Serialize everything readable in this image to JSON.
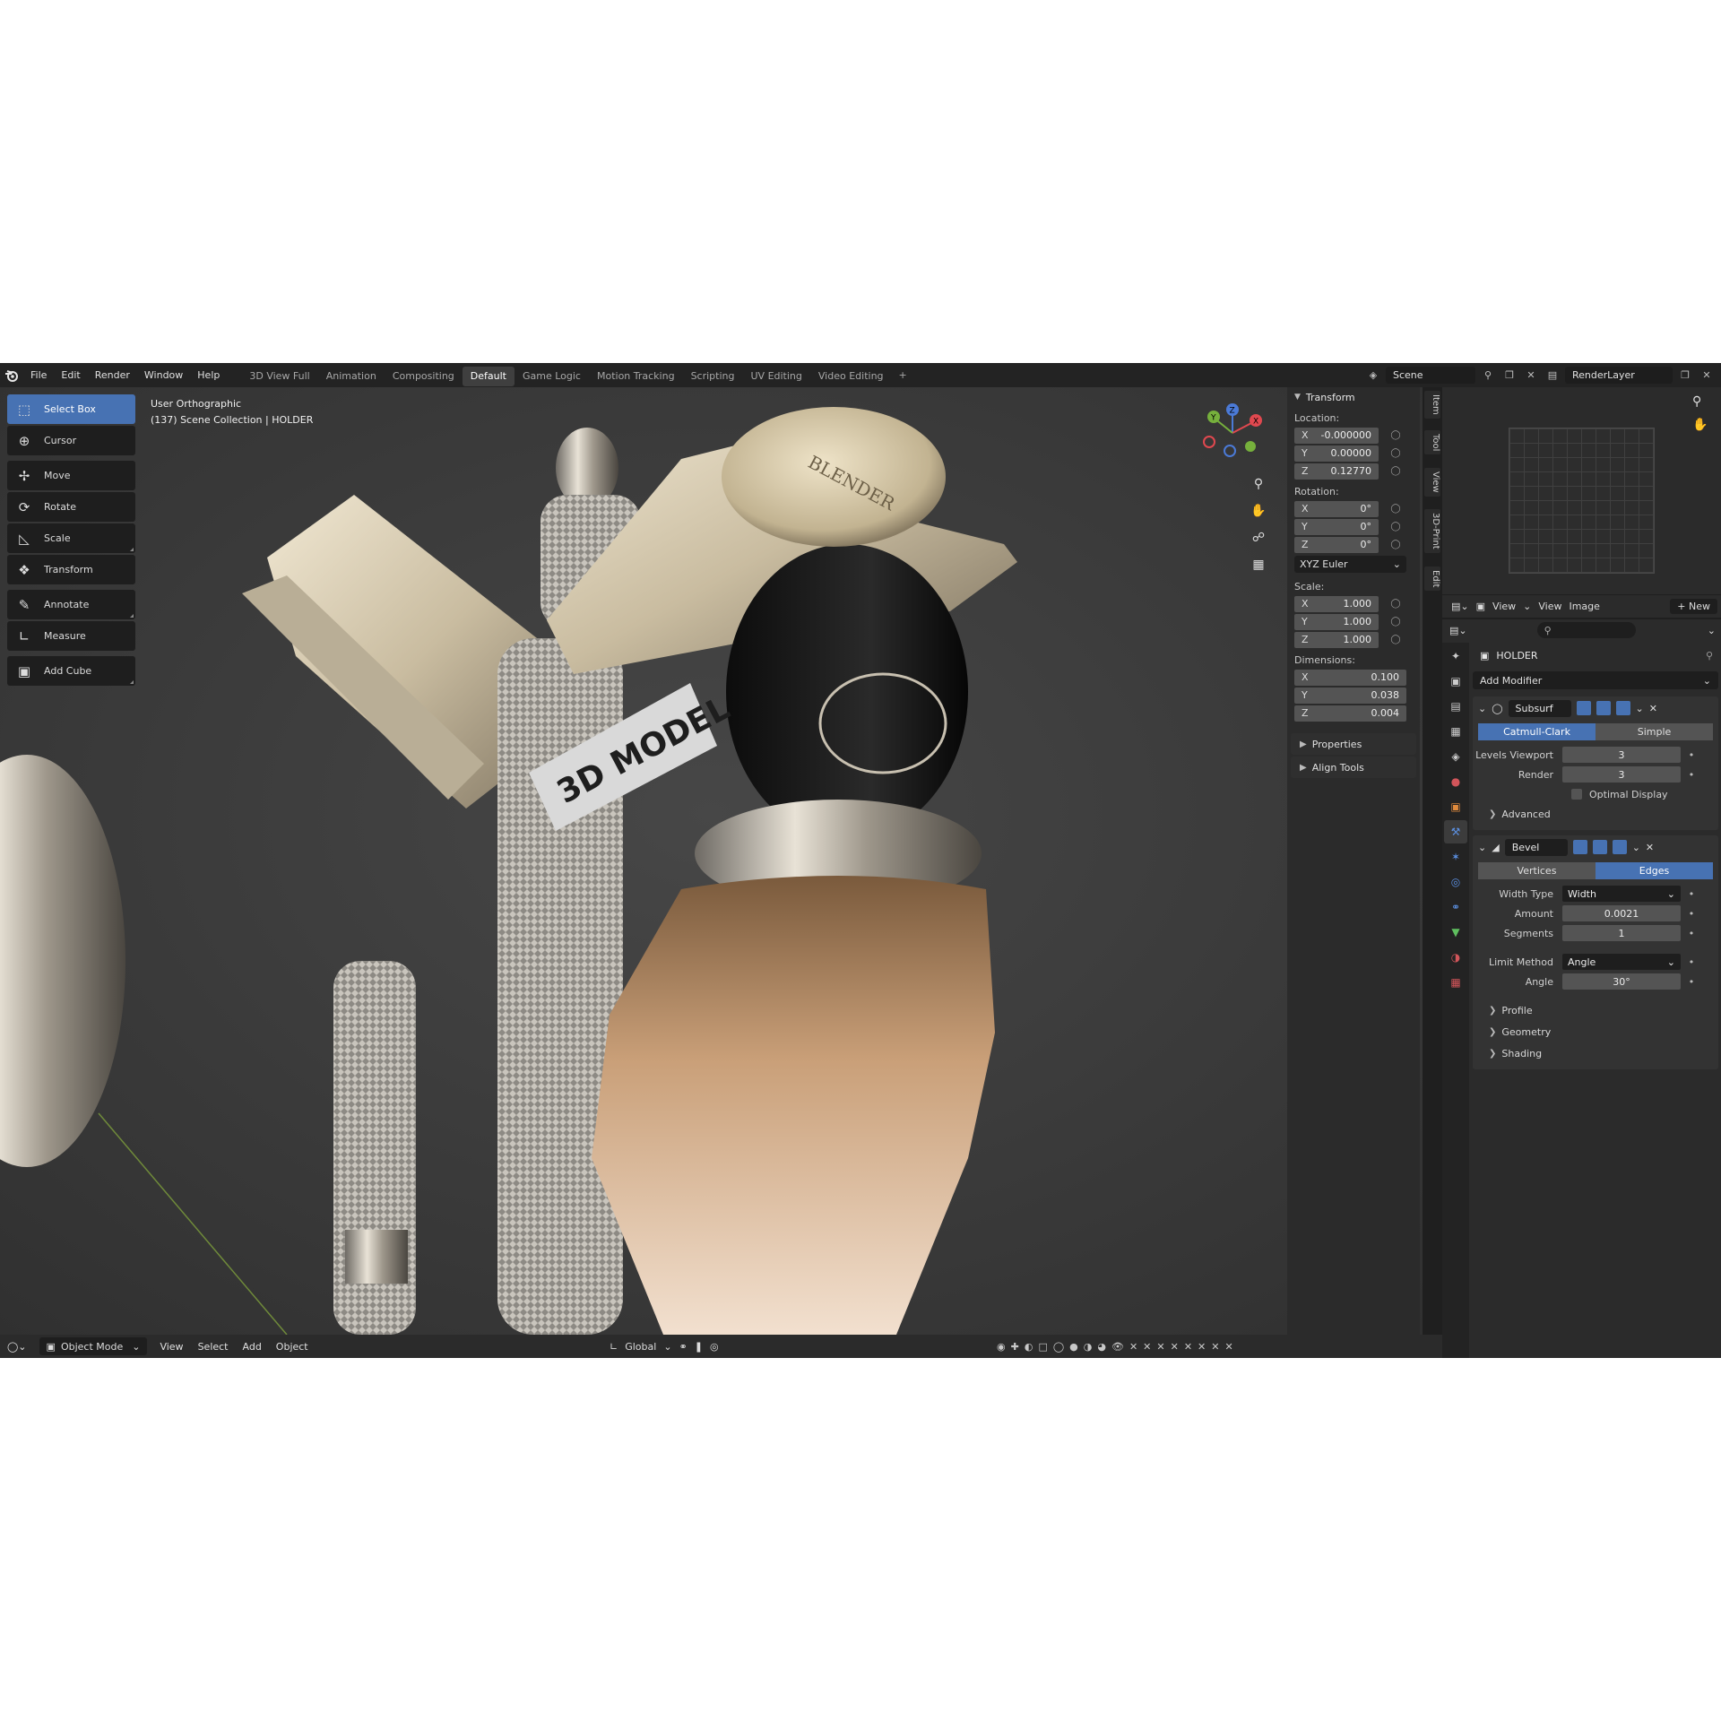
{
  "topbar": {
    "menu": [
      "File",
      "Edit",
      "Render",
      "Window",
      "Help"
    ],
    "tabs": [
      "3D View Full",
      "Animation",
      "Compositing",
      "Default",
      "Game Logic",
      "Motion Tracking",
      "Scripting",
      "UV Editing",
      "Video Editing"
    ],
    "active_tab": "Default",
    "scene": "Scene",
    "render_layer": "RenderLayer"
  },
  "viewport": {
    "view_name": "User Orthographic",
    "collection": "(137) Scene Collection | HOLDER",
    "label_text": "3D MODEL",
    "engraving": "BLENDER"
  },
  "toolbar": {
    "tools": [
      {
        "label": "Select Box",
        "icon": "select-box-icon",
        "active": true
      },
      {
        "label": "Cursor",
        "icon": "cursor-icon",
        "active": false
      },
      {
        "label": "Move",
        "icon": "move-icon",
        "active": false
      },
      {
        "label": "Rotate",
        "icon": "rotate-icon",
        "active": false
      },
      {
        "label": "Scale",
        "icon": "scale-icon",
        "active": false
      },
      {
        "label": "Transform",
        "icon": "transform-icon",
        "active": false
      },
      {
        "label": "Annotate",
        "icon": "annotate-icon",
        "active": false
      },
      {
        "label": "Measure",
        "icon": "measure-icon",
        "active": false
      },
      {
        "label": "Add Cube",
        "icon": "add-cube-icon",
        "active": false
      }
    ]
  },
  "npanel": {
    "title": "Transform",
    "location_label": "Location:",
    "location": {
      "x": "-0.000000",
      "y": "0.00000",
      "z": "0.12770"
    },
    "rotation_label": "Rotation:",
    "rotation": {
      "x": "0°",
      "y": "0°",
      "z": "0°"
    },
    "rotation_mode": "XYZ Euler",
    "scale_label": "Scale:",
    "scale": {
      "x": "1.000",
      "y": "1.000",
      "z": "1.000"
    },
    "dimensions_label": "Dimensions:",
    "dimensions": {
      "x": "0.100",
      "y": "0.038",
      "z": "0.004"
    },
    "properties": "Properties",
    "align_tools": "Align Tools",
    "tabs": [
      "Item",
      "Tool",
      "View",
      "3D-Print",
      "Edit"
    ]
  },
  "bottombar": {
    "mode": "Object Mode",
    "menu": [
      "View",
      "Select",
      "Add",
      "Object"
    ],
    "orientation": "Global"
  },
  "image_editor": {
    "menu": [
      "View",
      "View",
      "Image"
    ],
    "new_label": "New"
  },
  "properties": {
    "object_name": "HOLDER",
    "add_modifier": "Add Modifier",
    "subsurf": {
      "name": "Subsurf",
      "mode_a": "Catmull-Clark",
      "mode_b": "Simple",
      "levels_label": "Levels Viewport",
      "levels": "3",
      "render_label": "Render",
      "render": "3",
      "optimal_display": "Optimal Display",
      "advanced": "Advanced"
    },
    "bevel": {
      "name": "Bevel",
      "mode_a": "Vertices",
      "mode_b": "Edges",
      "width_type_label": "Width Type",
      "width_type": "Width",
      "amount_label": "Amount",
      "amount": "0.0021",
      "segments_label": "Segments",
      "segments": "1",
      "limit_label": "Limit Method",
      "limit": "Angle",
      "angle_label": "Angle",
      "angle": "30°",
      "profile": "Profile",
      "geometry": "Geometry",
      "shading": "Shading"
    }
  },
  "colors": {
    "accent": "#4772b3",
    "panel": "#2b2b2b",
    "header": "#232323"
  }
}
